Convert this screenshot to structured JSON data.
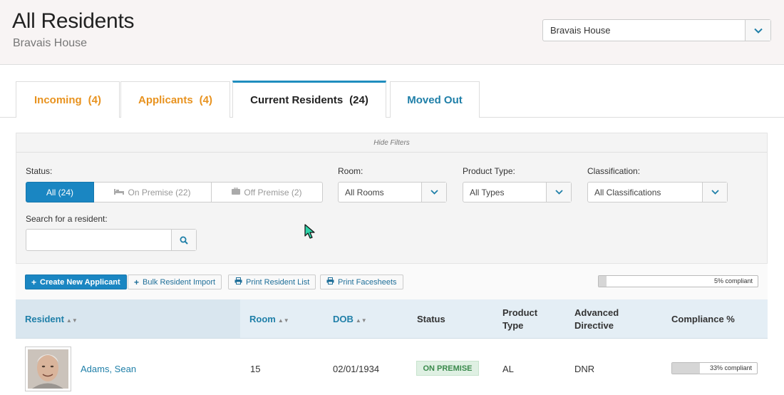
{
  "header": {
    "title": "All Residents",
    "subtitle": "Bravais House",
    "house_select": {
      "value": "Bravais House"
    }
  },
  "tabs": [
    {
      "label": "Incoming",
      "count": "(4)",
      "color": "#e8921e"
    },
    {
      "label": "Applicants",
      "count": "(4)",
      "color": "#e8921e"
    },
    {
      "label": "Current Residents",
      "count": "(24)",
      "active": true
    },
    {
      "label": "Moved Out",
      "color": "#1f7fa8"
    }
  ],
  "filters": {
    "hide_label": "Hide Filters",
    "status_label": "Status:",
    "status_options": [
      "All (24)",
      "On Premise (22)",
      "Off Premise (2)"
    ],
    "room_label": "Room:",
    "room_value": "All Rooms",
    "product_type_label": "Product Type:",
    "product_type_value": "All Types",
    "classification_label": "Classification:",
    "classification_value": "All Classifications",
    "search_label": "Search for a resident:",
    "search_value": ""
  },
  "toolbar": {
    "create_label": "Create New Applicant",
    "bulk_label": "Bulk Resident Import",
    "print_list_label": "Print Resident List",
    "print_facesheets_label": "Print Facesheets",
    "overall_compliance": {
      "percent": 5,
      "label": "5% compliant"
    }
  },
  "table": {
    "headers": [
      "Resident",
      "Room",
      "DOB",
      "Status",
      "Product Type",
      "Advanced Directive",
      "Compliance %"
    ],
    "rows": [
      {
        "name": "Adams, Sean",
        "room": "15",
        "dob": "02/01/1934",
        "status": "ON PREMISE",
        "product_type": "AL",
        "directive": "DNR",
        "compliance": {
          "percent": 33,
          "label": "33% compliant"
        }
      }
    ]
  },
  "colors": {
    "accent": "#1a86c2",
    "orange": "#e8921e",
    "link": "#1f7fa8"
  }
}
